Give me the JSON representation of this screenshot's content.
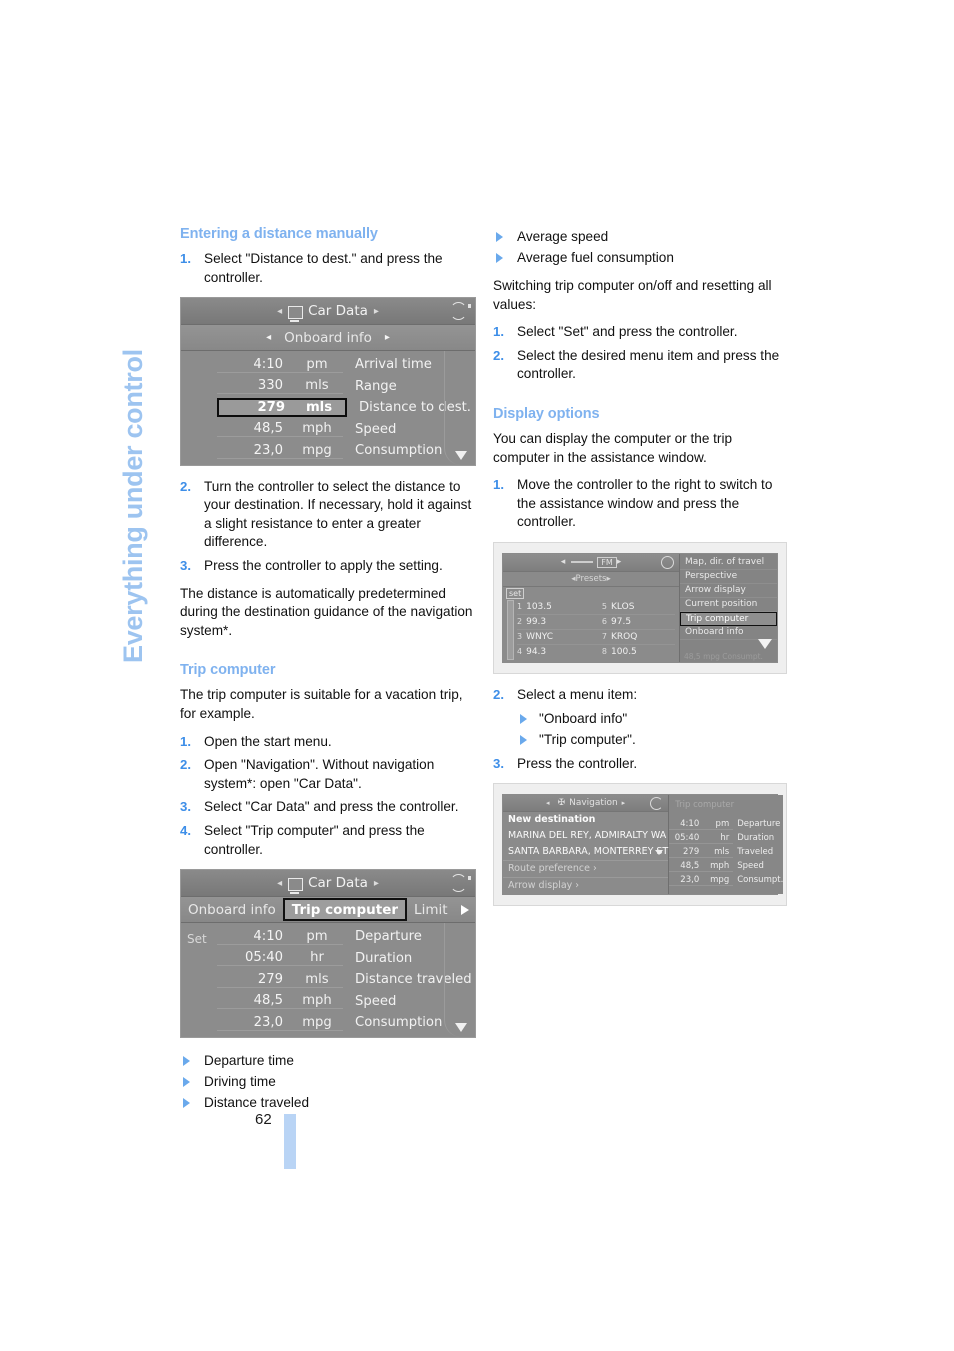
{
  "sidebar": {
    "chapter_label": "Everything under control"
  },
  "page": {
    "number": "62"
  },
  "left_column": {
    "heading_1": "Entering a distance manually",
    "steps_1": [
      "Select \"Distance to dest.\" and press the controller."
    ],
    "figure_1": {
      "title": "Car Data",
      "tab": "Onboard info",
      "rows": [
        {
          "value": "4:10",
          "unit": "pm",
          "label": "Arrival time",
          "highlight": false
        },
        {
          "value": "330",
          "unit": "mls",
          "label": "Range",
          "highlight": false
        },
        {
          "value": "279",
          "unit": "mls",
          "label": "Distance to dest.",
          "highlight": true
        },
        {
          "value": "48,5",
          "unit": "mph",
          "label": "Speed",
          "highlight": false
        },
        {
          "value": "23,0",
          "unit": "mpg",
          "label": "Consumption",
          "highlight": false
        }
      ]
    },
    "steps_2": [
      "Turn the controller to select the distance to your destination. If necessary, hold it against a slight resistance to enter a greater difference.",
      "Press the controller to apply the setting."
    ],
    "paragraph_1": "The distance is automatically predetermined during the destination guidance of the navigation system*.",
    "heading_2": "Trip computer",
    "paragraph_2": "The trip computer is suitable for a vacation trip, for example.",
    "steps_3": [
      "Open the start menu.",
      "Open \"Navigation\". Without navigation system*: open \"Car Data\".",
      "Select \"Car Data\" and press the controller.",
      "Select \"Trip computer\" and press the controller."
    ],
    "figure_2": {
      "title": "Car Data",
      "tabs": [
        {
          "label": "Onboard info",
          "selected": false
        },
        {
          "label": "Trip computer",
          "selected": true
        },
        {
          "label": "Limit",
          "selected": false
        }
      ],
      "set_label": "Set",
      "rows": [
        {
          "value": "4:10",
          "unit": "pm",
          "label": "Departure"
        },
        {
          "value": "05:40",
          "unit": "hr",
          "label": "Duration"
        },
        {
          "value": "279",
          "unit": "mls",
          "label": "Distance traveled"
        },
        {
          "value": "48,5",
          "unit": "mph",
          "label": "Speed"
        },
        {
          "value": "23,0",
          "unit": "mpg",
          "label": "Consumption"
        }
      ]
    },
    "bullets_1": [
      "Departure time",
      "Driving time",
      "Distance traveled"
    ]
  },
  "right_column": {
    "bullets_1": [
      "Average speed",
      "Average fuel consumption"
    ],
    "paragraph_1": "Switching trip computer on/off and resetting all values:",
    "steps_1": [
      "Select \"Set\" and press the controller.",
      "Select the desired menu item and press the controller."
    ],
    "heading_1": "Display options",
    "paragraph_2": "You can display the computer or the trip computer in the assistance window.",
    "steps_2": [
      "Move the controller to the right to switch to the assistance window and press the controller."
    ],
    "figure_1": {
      "radio": {
        "header": "FM",
        "subheader": "Presets",
        "set_label": "set",
        "presets": [
          {
            "left_num": "1",
            "left": "103.5",
            "right_num": "5",
            "right": "KLOS"
          },
          {
            "left_num": "2",
            "left": "99.3",
            "right_num": "6",
            "right": "97.5"
          },
          {
            "left_num": "3",
            "left": "WNYC",
            "right_num": "7",
            "right": "KROQ"
          },
          {
            "left_num": "4",
            "left": "94.3",
            "right_num": "8",
            "right": "100.5"
          }
        ]
      },
      "popup_items": [
        {
          "label": "Map, dir. of travel",
          "selected": false
        },
        {
          "label": "Perspective",
          "selected": false
        },
        {
          "label": "Arrow display",
          "selected": false
        },
        {
          "label": "Current position",
          "selected": false
        },
        {
          "label": "Trip computer",
          "selected": true
        },
        {
          "label": "Onboard info",
          "selected": false
        }
      ],
      "popup_ghost": "48,5   mpg   Consumpt."
    },
    "steps_3_intro": "Select a menu item:",
    "menu_choices": [
      "\"Onboard info\"",
      "\"Trip computer\"."
    ],
    "steps_3_last": "Press the controller.",
    "figure_2": {
      "nav": {
        "title": "Navigation",
        "lines": [
          {
            "text": "New destination",
            "style": "bold"
          },
          {
            "text": "MARINA DEL REY, ADMIRALTY WA",
            "style": "plain"
          },
          {
            "text": "SANTA BARBARA, MONTERREY ST",
            "style": "plain",
            "caret": true
          },
          {
            "text": "Route preference ›",
            "style": "dim"
          },
          {
            "text": "Arrow display ›",
            "style": "dim"
          }
        ]
      },
      "trip": {
        "title": "Trip computer",
        "rows": [
          {
            "value": "4:10",
            "unit": "pm",
            "label": "Departure"
          },
          {
            "value": "05:40",
            "unit": "hr",
            "label": "Duration"
          },
          {
            "value": "279",
            "unit": "mls",
            "label": "Traveled"
          },
          {
            "value": "48,5",
            "unit": "mph",
            "label": "Speed"
          },
          {
            "value": "23,0",
            "unit": "mpg",
            "label": "Consumpt."
          }
        ]
      }
    }
  }
}
